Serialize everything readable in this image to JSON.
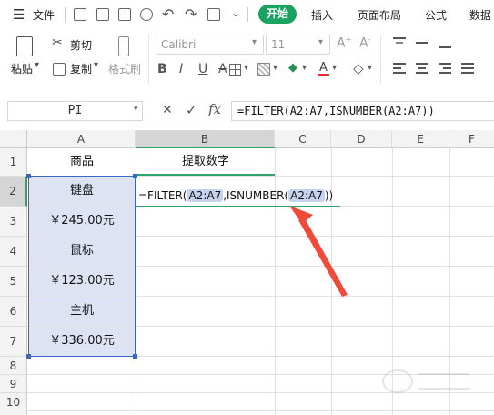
{
  "menu": {
    "file": "文件",
    "tabs": [
      "开始",
      "插入",
      "页面布局",
      "公式",
      "数据"
    ]
  },
  "ribbon": {
    "paste": "粘贴",
    "cut": "剪切",
    "copy": "复制",
    "format_painter": "格式刷",
    "font_name": "Calibri",
    "font_size": "11"
  },
  "formula_bar": {
    "name_box": "PI",
    "cancel": "✕",
    "confirm": "✓",
    "fx": "fx",
    "formula": "=FILTER(A2:A7,ISNUMBER(A2:A7))"
  },
  "sheet": {
    "columns": [
      "A",
      "B",
      "C",
      "D",
      "E",
      "F"
    ],
    "rows": [
      "1",
      "2",
      "3",
      "4",
      "5",
      "6",
      "7",
      "8",
      "9",
      "10"
    ],
    "A1": "商品",
    "B1": "提取数字",
    "A_values": [
      "键盘",
      "￥245.00元",
      "鼠标",
      "￥123.00元",
      "主机",
      "￥336.00元"
    ],
    "B2_edit": {
      "prefix": "=FILTER(",
      "ref1": "A2:A7",
      "middle": ",ISNUMBER(",
      "ref2": "A2:A7",
      "suffix": "))"
    }
  },
  "colors": {
    "accent_green": "#1aa260",
    "selection_fill": "#dde3f3",
    "selection_border": "#3a66c4",
    "arrow_red": "#f04a3a"
  }
}
